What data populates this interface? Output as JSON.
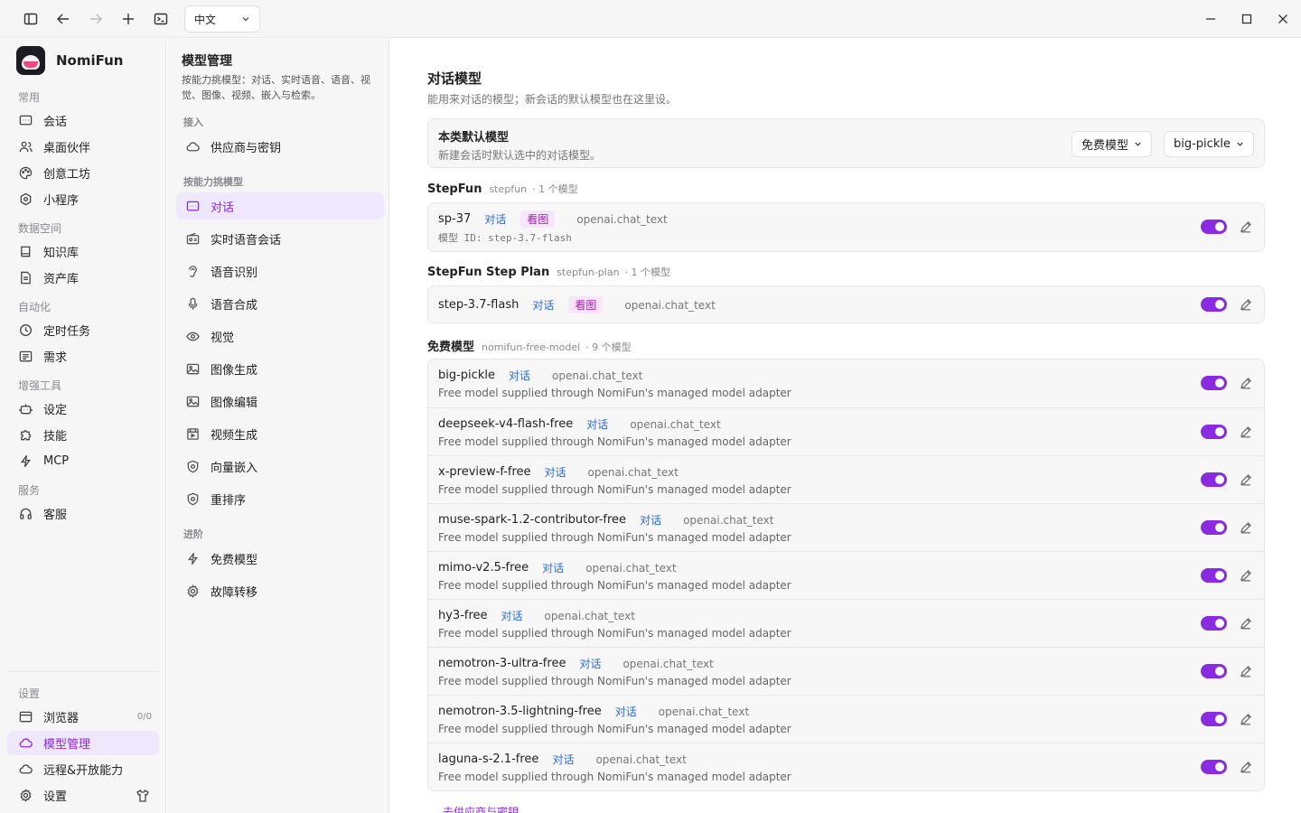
{
  "titlebar": {
    "language": "中文"
  },
  "app": {
    "name": "NomiFun"
  },
  "sidebar": {
    "sections": {
      "common": "常用",
      "data": "数据空间",
      "automation": "自动化",
      "tools": "增强工具",
      "service": "服务",
      "settings": "设置"
    },
    "items": {
      "chat": "会话",
      "desktop": "桌面伙伴",
      "workshop": "创意工坊",
      "miniapp": "小程序",
      "knowledge": "知识库",
      "assets": "资产库",
      "scheduled": "定时任务",
      "requirements": "需求",
      "setup": "设定",
      "skills": "技能",
      "mcp": "MCP",
      "support": "客服",
      "browser": "浏览器",
      "browser_badge": "0/0",
      "models": "模型管理",
      "remote": "远程&开放能力",
      "settings": "设置"
    }
  },
  "middle": {
    "title": "模型管理",
    "desc": "按能力挑模型：对话、实时语音、语音、视觉、图像、视频、嵌入与检索。",
    "sec_access": "接入",
    "sec_capability": "按能力挑模型",
    "sec_advanced": "进阶",
    "items": {
      "providers": "供应商与密钥",
      "chat": "对话",
      "realtime": "实时语音会话",
      "asr": "语音识别",
      "tts": "语音合成",
      "vision": "视觉",
      "imggen": "图像生成",
      "imgedit": "图像编辑",
      "videogen": "视频生成",
      "embedding": "向量嵌入",
      "rerank": "重排序",
      "free": "免费模型",
      "failover": "故障转移"
    }
  },
  "main": {
    "title": "对话模型",
    "desc": "能用来对话的模型；新会话的默认模型也在这里设。",
    "default": {
      "title": "本类默认模型",
      "desc": "新建会话时默认选中的对话模型。",
      "provider": "免费模型",
      "model": "big-pickle"
    },
    "tags": {
      "chat": "对话",
      "vision": "看图"
    },
    "groups": [
      {
        "name": "StepFun",
        "id": "stepfun",
        "count": "· 1 个模型"
      },
      {
        "name": "StepFun Step Plan",
        "id": "stepfun-plan",
        "count": "· 1 个模型"
      },
      {
        "name": "免费模型",
        "id": "nomifun-free-model",
        "count": "· 9 个模型"
      }
    ],
    "stepfun_model": {
      "name": "sp-37",
      "protocol": "openai.chat_text",
      "meta": "模型 ID: step-3.7-flash"
    },
    "stepplan_model": {
      "name": "step-3.7-flash",
      "protocol": "openai.chat_text"
    },
    "free_desc": "Free model supplied through NomiFun's managed model adapter",
    "free_models": [
      {
        "name": "big-pickle",
        "protocol": "openai.chat_text"
      },
      {
        "name": "deepseek-v4-flash-free",
        "protocol": "openai.chat_text"
      },
      {
        "name": "x-preview-f-free",
        "protocol": "openai.chat_text"
      },
      {
        "name": "muse-spark-1.2-contributor-free",
        "protocol": "openai.chat_text"
      },
      {
        "name": "mimo-v2.5-free",
        "protocol": "openai.chat_text"
      },
      {
        "name": "hy3-free",
        "protocol": "openai.chat_text"
      },
      {
        "name": "nemotron-3-ultra-free",
        "protocol": "openai.chat_text"
      },
      {
        "name": "nemotron-3.5-lightning-free",
        "protocol": "openai.chat_text"
      },
      {
        "name": "laguna-s-2.1-free",
        "protocol": "openai.chat_text"
      }
    ],
    "footer_link": "去供应商与密钥"
  }
}
